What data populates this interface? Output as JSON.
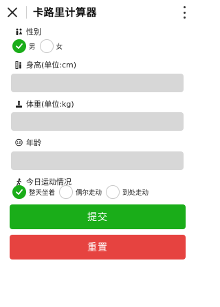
{
  "header": {
    "title": "卡路里计算器"
  },
  "form": {
    "gender": {
      "label": "性别",
      "options": [
        {
          "label": "男",
          "checked": true
        },
        {
          "label": "女",
          "checked": false
        }
      ]
    },
    "height": {
      "label": "身高(单位:cm)",
      "value": ""
    },
    "weight": {
      "label": "体重(单位:kg)",
      "value": ""
    },
    "age": {
      "label": "年龄",
      "value": ""
    },
    "activity": {
      "label": "今日运动情况",
      "options": [
        {
          "label": "整天坐着",
          "checked": true
        },
        {
          "label": "偶尔走动",
          "checked": false
        },
        {
          "label": "到处走动",
          "checked": false
        }
      ]
    }
  },
  "buttons": {
    "submit": "提交",
    "reset": "重置"
  },
  "colors": {
    "primary": "#1aad19",
    "danger": "#e64340",
    "input_bg": "#d7d7d7"
  },
  "icons": {
    "close": "close-icon",
    "more": "more-vertical-icon",
    "gender": "gender-icon",
    "height": "height-icon",
    "weight": "weight-icon",
    "age": "age-icon",
    "activity": "activity-icon",
    "check": "check-icon"
  }
}
